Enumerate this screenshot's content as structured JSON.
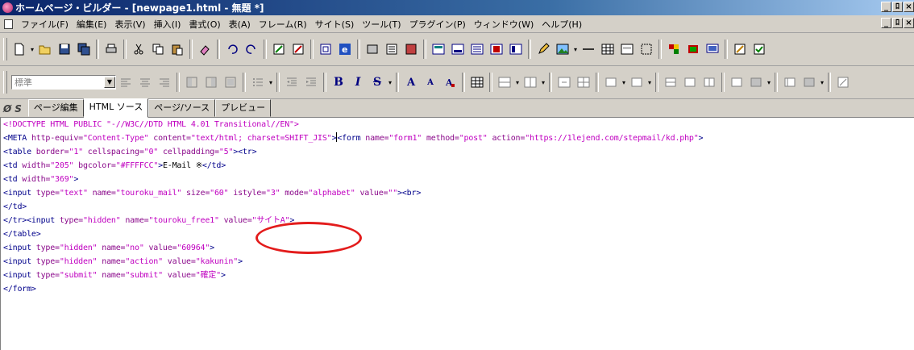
{
  "window": {
    "title": "ホームページ・ビルダー - [newpage1.html - 無題 *]",
    "controls": [
      "_",
      "ﾛ",
      "×"
    ]
  },
  "menubar": {
    "items": [
      "ファイル(F)",
      "編集(E)",
      "表示(V)",
      "挿入(I)",
      "書式(O)",
      "表(A)",
      "フレーム(R)",
      "サイト(S)",
      "ツール(T)",
      "プラグイン(P)",
      "ウィンドウ(W)",
      "ヘルプ(H)"
    ],
    "controls": [
      "_",
      "ﾛ",
      "×"
    ]
  },
  "toolbar2": {
    "style_select": "標準"
  },
  "format": {
    "bold": "B",
    "italic": "I",
    "strike": "S",
    "grow": "A",
    "shrink": "A"
  },
  "tabs": {
    "icon1": "Ø",
    "icon2": "S",
    "items": [
      "ページ編集",
      "HTML ソース",
      "ページ/ソース",
      "プレビュー"
    ],
    "active": 1
  },
  "source": {
    "line1": "<!DOCTYPE HTML PUBLIC \"-//W3C//DTD HTML 4.01 Transitional//EN\">",
    "line2a_tag": "<META ",
    "line2a_attr": "http-equiv=",
    "line2a_val": "\"Content-Type\" ",
    "line2b_attr": "content=",
    "line2b_val": "\"text/html; charset=SHIFT_JIS\"",
    "line2b_end": ">",
    "line2c_tag": "<form ",
    "line2c_attr1": "name=",
    "line2c_val1": "\"form1\" ",
    "line2c_attr2": "method=",
    "line2c_val2": "\"post\" ",
    "line2c_attr3": "action=",
    "line2c_val3": "\"https://1lejend.com/stepmail/kd.php\"",
    "line2c_end": ">",
    "line3_tag": "<table ",
    "line3_attr1": "border=",
    "line3_val1": "\"1\" ",
    "line3_attr2": "cellspacing=",
    "line3_val2": "\"0\" ",
    "line3_attr3": "cellpadding=",
    "line3_val3": "\"5\"",
    "line3_end": "><tr>",
    "line4_tag": "<td ",
    "line4_attr1": "width=",
    "line4_val1": "\"205\" ",
    "line4_attr2": "bgcolor=",
    "line4_val2": "\"#FFFFCC\"",
    "line4_end": ">",
    "line4_text": "E-Mail ※",
    "line4_close": "</td>",
    "line5_tag": "<td ",
    "line5_attr": "width=",
    "line5_val": "\"369\"",
    "line5_end": ">",
    "line6_tag": "<input ",
    "line6_attr1": "type=",
    "line6_val1": "\"text\" ",
    "line6_attr2": "name=",
    "line6_val2": "\"touroku_mail\" ",
    "line6_attr3": "size=",
    "line6_val3": "\"60\" ",
    "line6_attr4": "istyle=",
    "line6_val4": "\"3\" ",
    "line6_attr5": "mode=",
    "line6_val5": "\"alphabet\" ",
    "line6_attr6": "value=",
    "line6_val6": "\"\"",
    "line6_end": "><br>",
    "line7": "</td>",
    "line8_tag": "</tr><input ",
    "line8_attr1": "type=",
    "line8_val1": "\"hidden\" ",
    "line8_attr2": "name=",
    "line8_val2": "\"touroku_free1\" ",
    "line8_attr3": "value=",
    "line8_val3": "\"サイトA\"",
    "line8_end": ">",
    "line9": "</table>",
    "line10_tag": "<input ",
    "line10_attr1": "type=",
    "line10_val1": "\"hidden\" ",
    "line10_attr2": "name=",
    "line10_val2": "\"no\" ",
    "line10_attr3": "value=",
    "line10_val3": "\"60964\"",
    "line10_end": ">",
    "line11_tag": "<input ",
    "line11_attr1": "type=",
    "line11_val1": "\"hidden\" ",
    "line11_attr2": "name=",
    "line11_val2": "\"action\" ",
    "line11_attr3": "value=",
    "line11_val3": "\"kakunin\"",
    "line11_end": ">",
    "line12_tag": "<input ",
    "line12_attr1": "type=",
    "line12_val1": "\"submit\" ",
    "line12_attr2": "name=",
    "line12_val2": "\"submit\" ",
    "line12_attr3": "value=",
    "line12_val3": "\"確定\"",
    "line12_end": ">",
    "line13": "</form>"
  },
  "colors": {
    "tag": "#00008b",
    "attribute": "#8b0a8b",
    "value": "#c000c0",
    "highlight": "#e31c1c"
  }
}
